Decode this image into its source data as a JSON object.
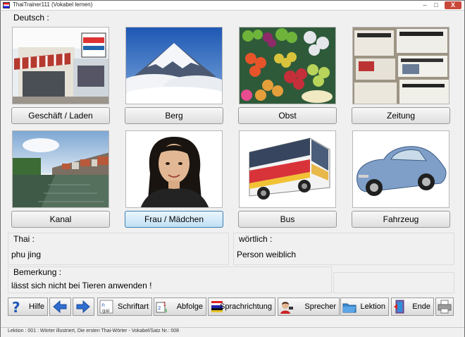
{
  "window": {
    "title": "ThaiTrainer111 (Vokabel lernen)",
    "close_symbol": "X",
    "min_symbol": "–",
    "max_symbol": "□"
  },
  "section": {
    "label": "Deutsch :"
  },
  "words": [
    {
      "label": "Geschäft / Laden",
      "image": "shop-image"
    },
    {
      "label": "Berg",
      "image": "mountain-image"
    },
    {
      "label": "Obst",
      "image": "fruit-image"
    },
    {
      "label": "Zeitung",
      "image": "newspaper-image"
    },
    {
      "label": "Kanal",
      "image": "canal-image"
    },
    {
      "label": "Frau / Mädchen",
      "image": "woman-image",
      "selected": true
    },
    {
      "label": "Bus",
      "image": "bus-image"
    },
    {
      "label": "Fahrzeug",
      "image": "car-image"
    }
  ],
  "thai": {
    "label": "Thai :",
    "value": "phu jing"
  },
  "literal": {
    "label": "wörtlich :",
    "value": "Person weiblich"
  },
  "remark": {
    "label": "Bemerkung :",
    "value": "lässt sich nicht bei Tieren anwenden !"
  },
  "toolbar": {
    "help": "Hilfe",
    "font": "Schriftart",
    "sequence": "Abfolge",
    "direction": "Sprachrichtung",
    "speaker": "Sprecher",
    "lesson": "Lektion",
    "end": "Ende",
    "icons": [
      "help-icon",
      "arrow-left-icon",
      "arrow-right-icon",
      "font-icon",
      "sequence-icon",
      "direction-icon",
      "speaker-icon",
      "folder-icon",
      "exit-icon",
      "printer-icon"
    ]
  },
  "status": {
    "text": "Lektion : 001 : Wörter illustriert, Die ersten Thai-Wörter - Vokabel/Satz Nr.: 008"
  }
}
